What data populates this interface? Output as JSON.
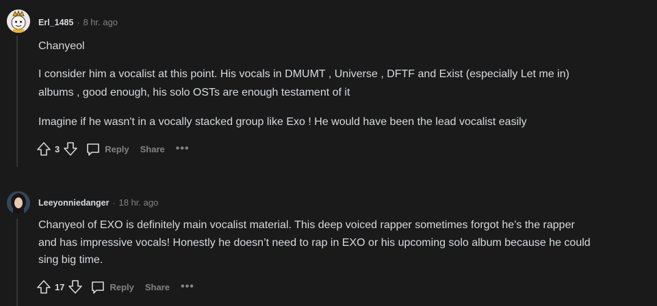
{
  "comments": [
    {
      "username": "Erl_1485",
      "separator": "·",
      "time": "8 hr. ago",
      "paragraphs": [
        "Chanyeol",
        "I consider him a vocalist at this point. His vocals in DMUMT , Universe , DFTF and Exist (especially Let me in)",
        "albums , good enough, his solo OSTs are enough testament of it",
        "Imagine if he wasn't in a vocally stacked group like Exo ! He would have been the lead vocalist easily"
      ],
      "score": "3",
      "reply_label": "Reply",
      "share_label": "Share",
      "more_label": "•••"
    },
    {
      "username": "Leeyonniedanger",
      "separator": "·",
      "time": "18 hr. ago",
      "paragraphs": [
        "Chanyeol of EXO is definitely main vocalist material. This deep voiced rapper sometimes forgot he’s the rapper",
        "and has impressive vocals! Honestly he doesn’t need to rap in EXO or his upcoming solo album because he could",
        "sing big time."
      ],
      "score": "17",
      "reply_label": "Reply",
      "share_label": "Share",
      "more_label": "•••"
    }
  ],
  "colors": {
    "background": "#1a1a1b",
    "text": "#d7dadc",
    "muted": "#818384",
    "thread_line": "#343536"
  },
  "icons": [
    "upvote-icon",
    "downvote-icon",
    "comment-bubble-icon",
    "more-icon"
  ]
}
